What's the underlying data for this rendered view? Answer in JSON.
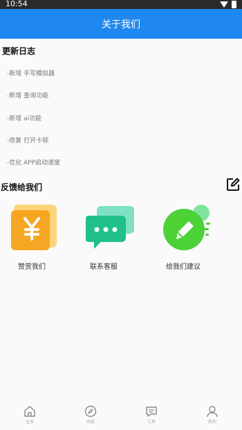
{
  "status": {
    "time": "10:54"
  },
  "header": {
    "title": "关于我们"
  },
  "changelog": {
    "title": "更新日志",
    "items": [
      "-新增  手写模拟器",
      "-新增  查询功能",
      "-新增  ai功能",
      "-修复  打开卡顿",
      "-优化  APP启动速度"
    ]
  },
  "feedback": {
    "title": "反馈给我们",
    "cards": [
      {
        "label": "赞赏我们",
        "icon": "yen-icon"
      },
      {
        "label": "联系客服",
        "icon": "chat-icon"
      },
      {
        "label": "给我们建议",
        "icon": "pencil-icon"
      }
    ]
  },
  "nav": {
    "items": [
      {
        "label": "主页",
        "icon": "home-icon"
      },
      {
        "label": "功能",
        "icon": "compass-icon"
      },
      {
        "label": "工具",
        "icon": "message-icon"
      },
      {
        "label": "我的",
        "icon": "user-icon"
      }
    ]
  },
  "colors": {
    "primary": "#1e88f0",
    "yen_light": "#fcd57a",
    "yen_dark": "#f5a623",
    "chat_light": "#7fe0c4",
    "chat_dark": "#1fc08a",
    "pencil_green": "#4cd137"
  }
}
